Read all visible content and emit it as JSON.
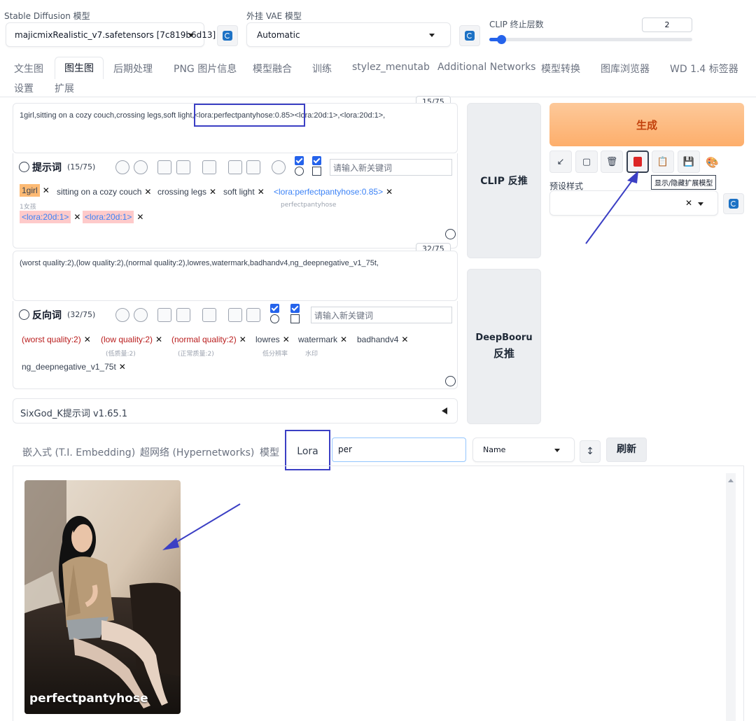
{
  "settings": {
    "sd_model_label": "Stable Diffusion 模型",
    "sd_model_value": "majicmixRealistic_v7.safetensors [7c819b6d13]",
    "vae_label": "外挂 VAE 模型",
    "vae_value": "Automatic",
    "clip_label": "CLIP 终止层数",
    "clip_value": "2",
    "clip_slider_fraction": 0.06
  },
  "tabs": {
    "row1": [
      "文生图",
      "图生图",
      "后期处理",
      "PNG 图片信息",
      "模型融合",
      "训练",
      "stylez_menutab",
      "Additional Networks",
      "模型转换",
      "图库浏览器",
      "WD 1.4 标签器"
    ],
    "row2": [
      "设置",
      "扩展"
    ],
    "active": "图生图"
  },
  "prompt": {
    "counter": "15/75",
    "text_a": "1girl,sitting on a cozy couch,crossing legs,soft light,",
    "text_b": "<lora:perfectpantyhose:0.85>",
    "text_c": "<lora:20d:1>,<lora:20d:1>,",
    "label": "提示词",
    "label_count": "(15/75)",
    "keyword_placeholder": "请输入新关键词",
    "chips": [
      {
        "text": "1girl",
        "sub": "1女孩"
      },
      {
        "text": "sitting on a cozy couch",
        "sub": ""
      },
      {
        "text": "crossing legs",
        "sub": ""
      },
      {
        "text": "soft light",
        "sub": ""
      },
      {
        "text": "<lora:perfectpantyhose:0.85>",
        "sub": "perfectpantyhose"
      },
      {
        "text": "<lora:20d:1>",
        "sub": ""
      },
      {
        "text": "<lora:20d:1>",
        "sub": ""
      }
    ]
  },
  "negative": {
    "counter": "32/75",
    "text": "(worst quality:2),(low quality:2),(normal quality:2),lowres,watermark,badhandv4,ng_deepnegative_v1_75t,",
    "label": "反向词",
    "label_count": "(32/75)",
    "keyword_placeholder": "请输入新关键词",
    "chips": [
      {
        "text": "(worst quality:2)",
        "sub": ""
      },
      {
        "text": "(low quality:2)",
        "sub": "(低质量:2)"
      },
      {
        "text": "(normal quality:2)",
        "sub": "(正常质量:2)"
      },
      {
        "text": "lowres",
        "sub": "低分辨率"
      },
      {
        "text": "watermark",
        "sub": "水印"
      },
      {
        "text": "badhandv4",
        "sub": ""
      },
      {
        "text": "ng_deepnegative_v1_75t",
        "sub": ""
      }
    ]
  },
  "sidebuttons": {
    "clip": "CLIP 反推",
    "deepbooru_1": "DeepBooru",
    "deepbooru_2": "反推"
  },
  "generate": {
    "label": "生成",
    "styles_label": "预设样式",
    "tooltip": "显示/隐藏扩展模型",
    "tools": [
      "↙",
      "▢",
      "🗑",
      "◘",
      "📋",
      "💾",
      "🎨"
    ]
  },
  "sixgod": "SixGod_K提示词 v1.65.1",
  "extra": {
    "tabs": [
      "嵌入式 (T.I. Embedding)",
      "超网络 (Hypernetworks)",
      "模型",
      "Lora"
    ],
    "search_value": "per",
    "sort_value": "Name",
    "sort_dir": "↕",
    "refresh": "刷新",
    "card_name": "perfectpantyhose"
  },
  "colors": {
    "accent": "#2563eb",
    "annotation": "#3b3fc4",
    "generate_from": "#fdba74",
    "generate_text": "#c2410c"
  }
}
